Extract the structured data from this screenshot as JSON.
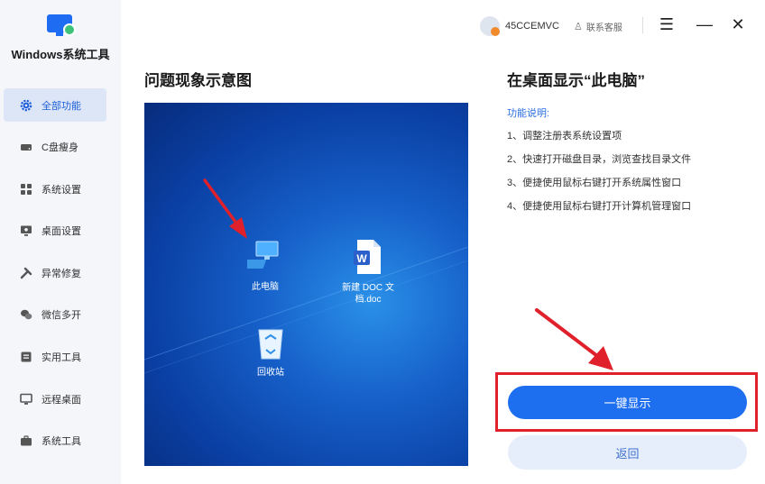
{
  "app": {
    "title": "Windows系统工具"
  },
  "sidebar": {
    "items": [
      {
        "label": "全部功能",
        "icon": "gear-icon"
      },
      {
        "label": "C盘瘦身",
        "icon": "drive-icon"
      },
      {
        "label": "系统设置",
        "icon": "grid-icon"
      },
      {
        "label": "桌面设置",
        "icon": "monitor-icon"
      },
      {
        "label": "异常修复",
        "icon": "wrench-icon"
      },
      {
        "label": "微信多开",
        "icon": "wechat-icon"
      },
      {
        "label": "实用工具",
        "icon": "toolbox-icon"
      },
      {
        "label": "远程桌面",
        "icon": "remote-desktop-icon"
      },
      {
        "label": "系统工具",
        "icon": "briefcase-icon"
      }
    ]
  },
  "topbar": {
    "username": "45CCEMVC",
    "service_label": "联系客服",
    "menu_glyph": "☰",
    "minimize_glyph": "—",
    "close_glyph": "✕"
  },
  "left": {
    "title": "问题现象示意图",
    "desktop_icons": {
      "computer": "此电脑",
      "doc_line1": "新建 DOC 文",
      "doc_line2": "档.doc",
      "recycle": "回收站"
    }
  },
  "right": {
    "title": "在桌面显示“此电脑”",
    "desc_label": "功能说明:",
    "desc_items": [
      "1、调整注册表系统设置项",
      "2、快速打开磁盘目录，浏览查找目录文件",
      "3、便捷使用鼠标右键打开系统属性窗口",
      "4、便捷使用鼠标右键打开计算机管理窗口"
    ],
    "primary_button": "一键显示",
    "secondary_button": "返回"
  },
  "colors": {
    "accent": "#1e6ff0",
    "sidebar_bg": "#f4f6fa",
    "active_nav_bg": "#dde6f7",
    "annotation_red": "#e0202a"
  }
}
